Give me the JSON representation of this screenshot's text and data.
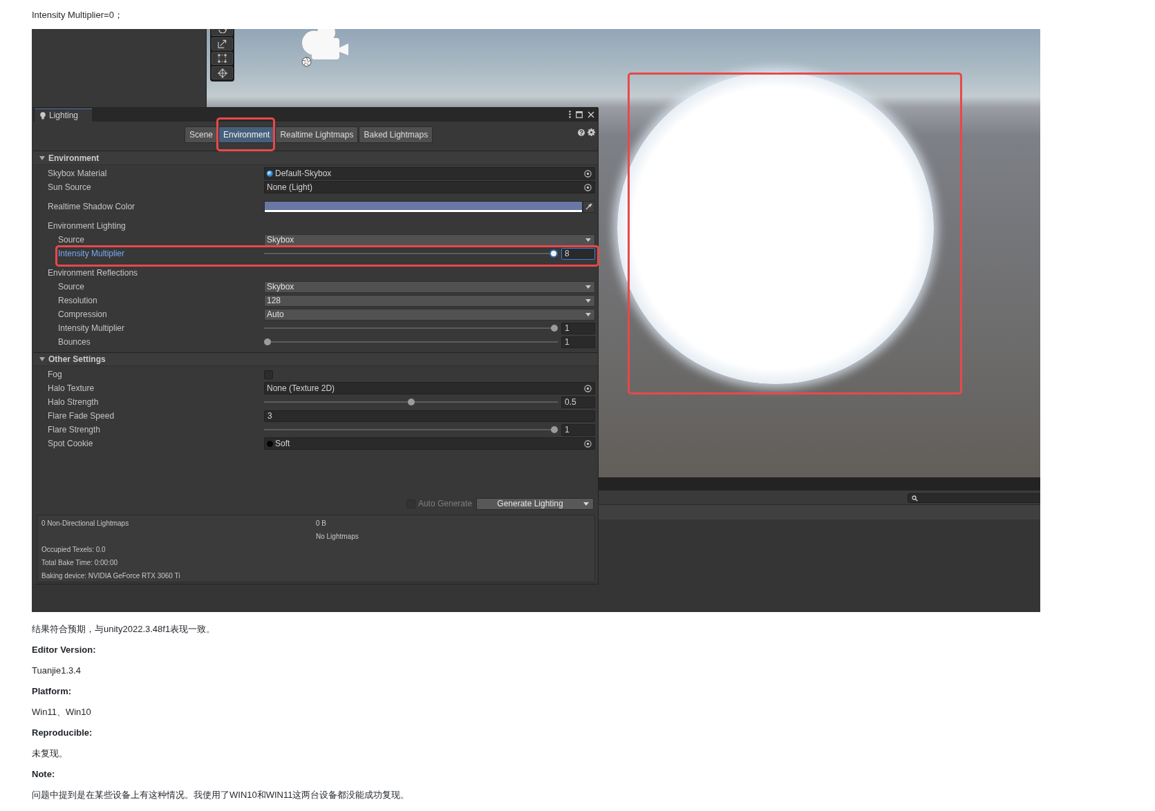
{
  "intro": "Intensity Multiplier=0；",
  "scene_view": {
    "highlighted": true
  },
  "lighting_window": {
    "tab": "Lighting",
    "mode_tabs": [
      {
        "label": "Scene",
        "selected": false,
        "highlighted": false
      },
      {
        "label": "Environment",
        "selected": true,
        "highlighted": true
      },
      {
        "label": "Realtime Lightmaps",
        "selected": false,
        "highlighted": false
      },
      {
        "label": "Baked Lightmaps",
        "selected": false,
        "highlighted": false
      }
    ],
    "sections": [
      {
        "title": "Environment",
        "expanded": true,
        "rows": [
          {
            "kind": "material",
            "label": "Skybox Material",
            "value": "Default-Skybox",
            "focused": false,
            "highlighted": false
          },
          {
            "kind": "object",
            "label": "Sun Source",
            "value": "None (Light)",
            "focused": false,
            "highlighted": false
          },
          {
            "kind": "color",
            "label": "Realtime Shadow Color",
            "color": "#6a77a5",
            "focused": false,
            "highlighted": false
          },
          {
            "kind": "group",
            "label": "Environment Lighting",
            "focused": false,
            "highlighted": false,
            "children": [
              {
                "kind": "dropdown",
                "label": "Source",
                "value": "Skybox",
                "focused": false,
                "highlighted": false
              },
              {
                "kind": "slider",
                "label": "Intensity Multiplier",
                "level": 1,
                "value": "8",
                "focused": true,
                "highlighted": true
              }
            ]
          },
          {
            "kind": "group",
            "label": "Environment Reflections",
            "focused": false,
            "highlighted": false,
            "children": [
              {
                "kind": "dropdown",
                "label": "Source",
                "value": "Skybox",
                "focused": false,
                "highlighted": false
              },
              {
                "kind": "dropdown",
                "label": "Resolution",
                "value": "128",
                "focused": false,
                "highlighted": false
              },
              {
                "kind": "dropdown",
                "label": "Compression",
                "value": "Auto",
                "focused": false,
                "highlighted": false
              },
              {
                "kind": "slider",
                "label": "Intensity Multiplier",
                "level": 1,
                "value": "1",
                "focused": false,
                "highlighted": false
              },
              {
                "kind": "slider",
                "label": "Bounces",
                "level": 0,
                "value": "1",
                "focused": false,
                "highlighted": false
              }
            ]
          }
        ]
      },
      {
        "title": "Other Settings",
        "expanded": true,
        "rows": [
          {
            "kind": "checkbox",
            "label": "Fog",
            "checked": false,
            "focused": false,
            "highlighted": false
          },
          {
            "kind": "object",
            "label": "Halo Texture",
            "value": "None (Texture 2D)",
            "focused": false,
            "highlighted": false
          },
          {
            "kind": "slider",
            "label": "Halo Strength",
            "level": 0.5,
            "value": "0.5",
            "focused": false,
            "highlighted": false
          },
          {
            "kind": "number",
            "label": "Flare Fade Speed",
            "value": "3",
            "focused": false,
            "highlighted": false
          },
          {
            "kind": "slider",
            "label": "Flare Strength",
            "level": 1,
            "value": "1",
            "focused": false,
            "highlighted": false
          },
          {
            "kind": "cookie",
            "label": "Spot Cookie",
            "value": "Soft",
            "focused": false,
            "highlighted": false
          }
        ]
      }
    ],
    "auto_generate": {
      "label": "Auto Generate",
      "checked": false,
      "disabled": true
    },
    "generate_button": "Generate Lighting",
    "bake_stats": {
      "lightmaps": "0 Non-Directional Lightmaps",
      "size": "0 B",
      "status": "No Lightmaps",
      "details": [
        "Occupied Texels: 0.0",
        "Total Bake Time: 0:00:00",
        "Baking device: NVIDIA GeForce RTX 3060 Ti"
      ]
    }
  },
  "body": [
    {
      "kind": "text",
      "text": "结果符合预期，与unity2022.3.48f1表现一致。"
    },
    {
      "kind": "heading",
      "text": "Editor Version:"
    },
    {
      "kind": "text",
      "text": "Tuanjie1.3.4"
    },
    {
      "kind": "heading",
      "text": "Platform:"
    },
    {
      "kind": "text",
      "text": "Win11、Win10"
    },
    {
      "kind": "heading",
      "text": "Reproducible:"
    },
    {
      "kind": "text",
      "text": "未复现。"
    },
    {
      "kind": "heading",
      "text": "Note:"
    },
    {
      "kind": "text",
      "text": "问题中提到是在某些设备上有这种情况。我使用了WIN10和WIN11这两台设备都没能成功复现。"
    }
  ]
}
